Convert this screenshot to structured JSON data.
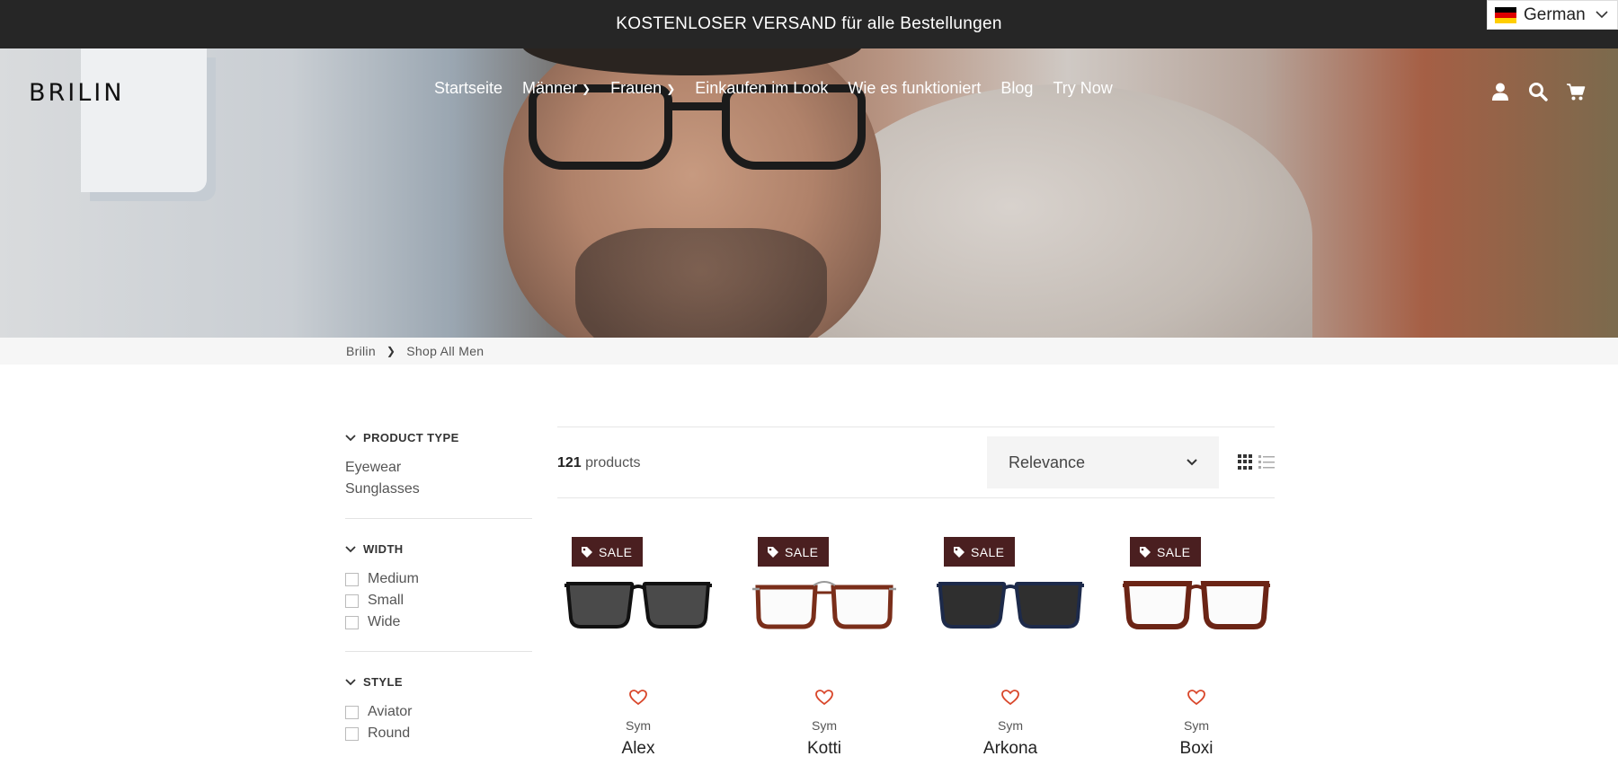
{
  "announcement": "KOSTENLOSER VERSAND für alle Bestellungen",
  "language": {
    "label": "German",
    "flag_colors": [
      "#000000",
      "#dd0000",
      "#ffce00"
    ]
  },
  "header": {
    "logo": "BRILIN",
    "nav": [
      {
        "label": "Startseite",
        "has_dropdown": false
      },
      {
        "label": "Männer",
        "has_dropdown": true
      },
      {
        "label": "Frauen",
        "has_dropdown": true
      },
      {
        "label": "Einkaufen im Look",
        "has_dropdown": false
      },
      {
        "label": "Wie es funktioniert",
        "has_dropdown": false
      },
      {
        "label": "Blog",
        "has_dropdown": false
      },
      {
        "label": "Try Now",
        "has_dropdown": false
      }
    ],
    "icons": [
      "user-icon",
      "search-icon",
      "cart-icon"
    ]
  },
  "breadcrumb": {
    "home": "Brilin",
    "current": "Shop All Men"
  },
  "filters": {
    "product_type": {
      "title": "PRODUCT TYPE",
      "items": [
        "Eyewear",
        "Sunglasses"
      ]
    },
    "width": {
      "title": "WIDTH",
      "items": [
        "Medium",
        "Small",
        "Wide"
      ]
    },
    "style": {
      "title": "STYLE",
      "items": [
        "Aviator",
        "Round"
      ]
    }
  },
  "toolbar": {
    "count": "121",
    "count_suffix": " products",
    "sort_value": "Relevance"
  },
  "colors": {
    "sale_badge": "#4a1f20",
    "heart": "#d9472b",
    "announcement_bg": "#262626"
  },
  "products": [
    {
      "badge": "SALE",
      "brand": "Sym",
      "name": "Alex",
      "frame_color": "#111111",
      "lens": "dark"
    },
    {
      "badge": "SALE",
      "brand": "Sym",
      "name": "Kotti",
      "frame_color": "#7a2e1a",
      "lens": "clear"
    },
    {
      "badge": "SALE",
      "brand": "Sym",
      "name": "Arkona",
      "frame_color": "#1d2a4a",
      "lens": "dark"
    },
    {
      "badge": "SALE",
      "brand": "Sym",
      "name": "Boxi",
      "frame_color": "#6b2415",
      "lens": "clear"
    }
  ]
}
